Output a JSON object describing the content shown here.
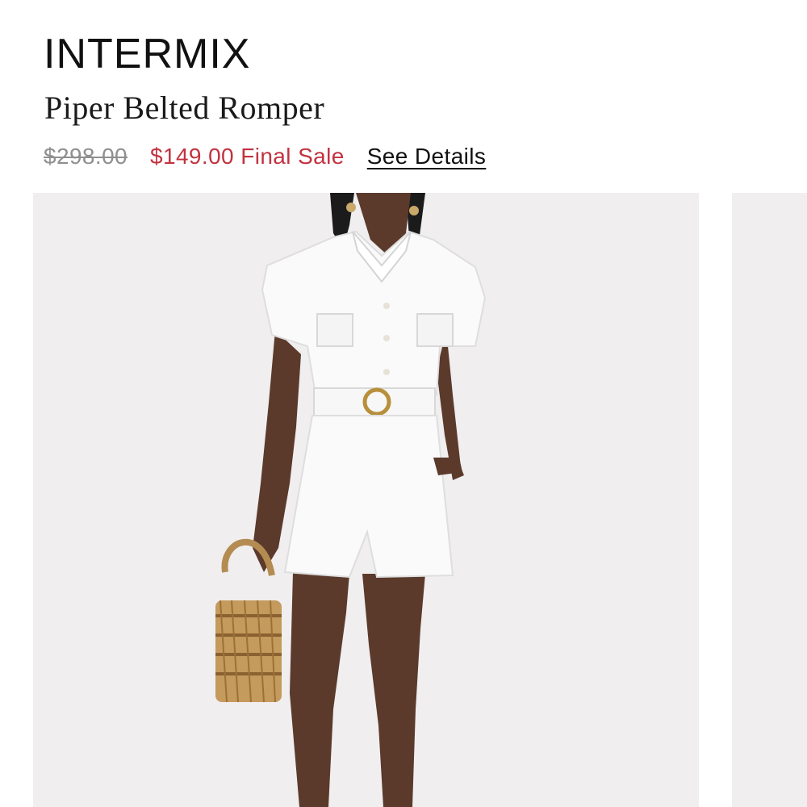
{
  "product": {
    "brand": "INTERMIX",
    "name": "Piper Belted Romper",
    "original_price": "$298.00",
    "sale_price": "$149.00 Final Sale",
    "details_link": "See Details"
  },
  "gallery": {
    "main_image": "model-wearing-white-belted-romper",
    "next_image": "partial-next-product-image"
  },
  "colors": {
    "sale": "#c2323f",
    "original": "#8f8f8f",
    "image_background": "#f0eeef"
  }
}
